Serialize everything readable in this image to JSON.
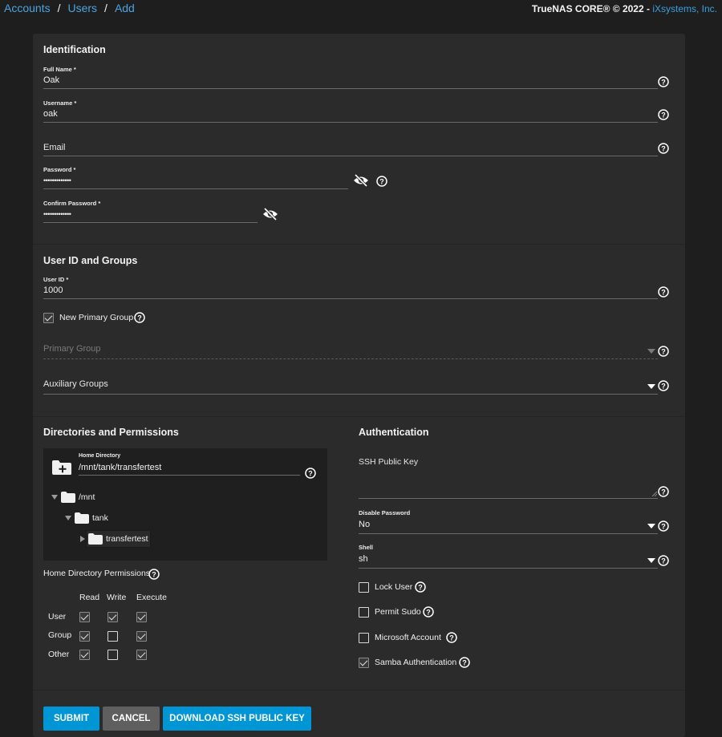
{
  "breadcrumb": [
    "Accounts",
    "Users",
    "Add"
  ],
  "brand": {
    "product": "TrueNAS CORE® © 2022 - ",
    "company": "iXsystems, Inc."
  },
  "identification": {
    "title": "Identification",
    "full_name": {
      "label": "Full Name *",
      "value": "Oak"
    },
    "username": {
      "label": "Username *",
      "value": "oak"
    },
    "email": {
      "placeholder": "Email",
      "value": ""
    },
    "password": {
      "label": "Password *",
      "value": "•••••••••••••"
    },
    "confirm_password": {
      "label": "Confirm Password *",
      "value": "•••••••••••••"
    }
  },
  "user_id_groups": {
    "title": "User ID and Groups",
    "user_id": {
      "label": "User ID *",
      "value": "1000"
    },
    "new_primary_group": {
      "label": "New Primary Group",
      "checked": true
    },
    "primary_group": {
      "placeholder": "Primary Group"
    },
    "auxiliary_groups": {
      "placeholder": "Auxiliary Groups"
    }
  },
  "directories": {
    "title": "Directories and Permissions",
    "home_directory": {
      "label": "Home Directory",
      "value": "/mnt/tank/transfertest"
    },
    "tree": [
      "/mnt",
      "tank",
      "transfertest"
    ],
    "permissions_title": "Home Directory Permissions",
    "columns": [
      "Read",
      "Write",
      "Execute"
    ],
    "rows": [
      {
        "name": "User",
        "read": true,
        "write": true,
        "execute": true
      },
      {
        "name": "Group",
        "read": true,
        "write": false,
        "execute": true
      },
      {
        "name": "Other",
        "read": true,
        "write": false,
        "execute": true
      }
    ]
  },
  "authentication": {
    "title": "Authentication",
    "ssh_key": {
      "placeholder": "SSH Public Key"
    },
    "disable_password": {
      "label": "Disable Password",
      "value": "No"
    },
    "shell": {
      "label": "Shell",
      "value": "sh"
    },
    "lock_user": {
      "label": "Lock User",
      "checked": false
    },
    "permit_sudo": {
      "label": "Permit Sudo",
      "checked": false
    },
    "microsoft_account": {
      "label": "Microsoft Account",
      "checked": false
    },
    "samba_auth": {
      "label": "Samba Authentication",
      "checked": true
    }
  },
  "buttons": {
    "submit": "SUBMIT",
    "cancel": "CANCEL",
    "download": "DOWNLOAD SSH PUBLIC KEY"
  },
  "colors": {
    "accent": "#0095d5",
    "link": "#4aa4e0",
    "card": "#2b2b2b",
    "background": "#1e1e1e"
  },
  "icons": [
    "help-icon",
    "eye-off-icon",
    "caret-down-icon",
    "folder-icon",
    "folder-add-icon",
    "check-icon"
  ]
}
